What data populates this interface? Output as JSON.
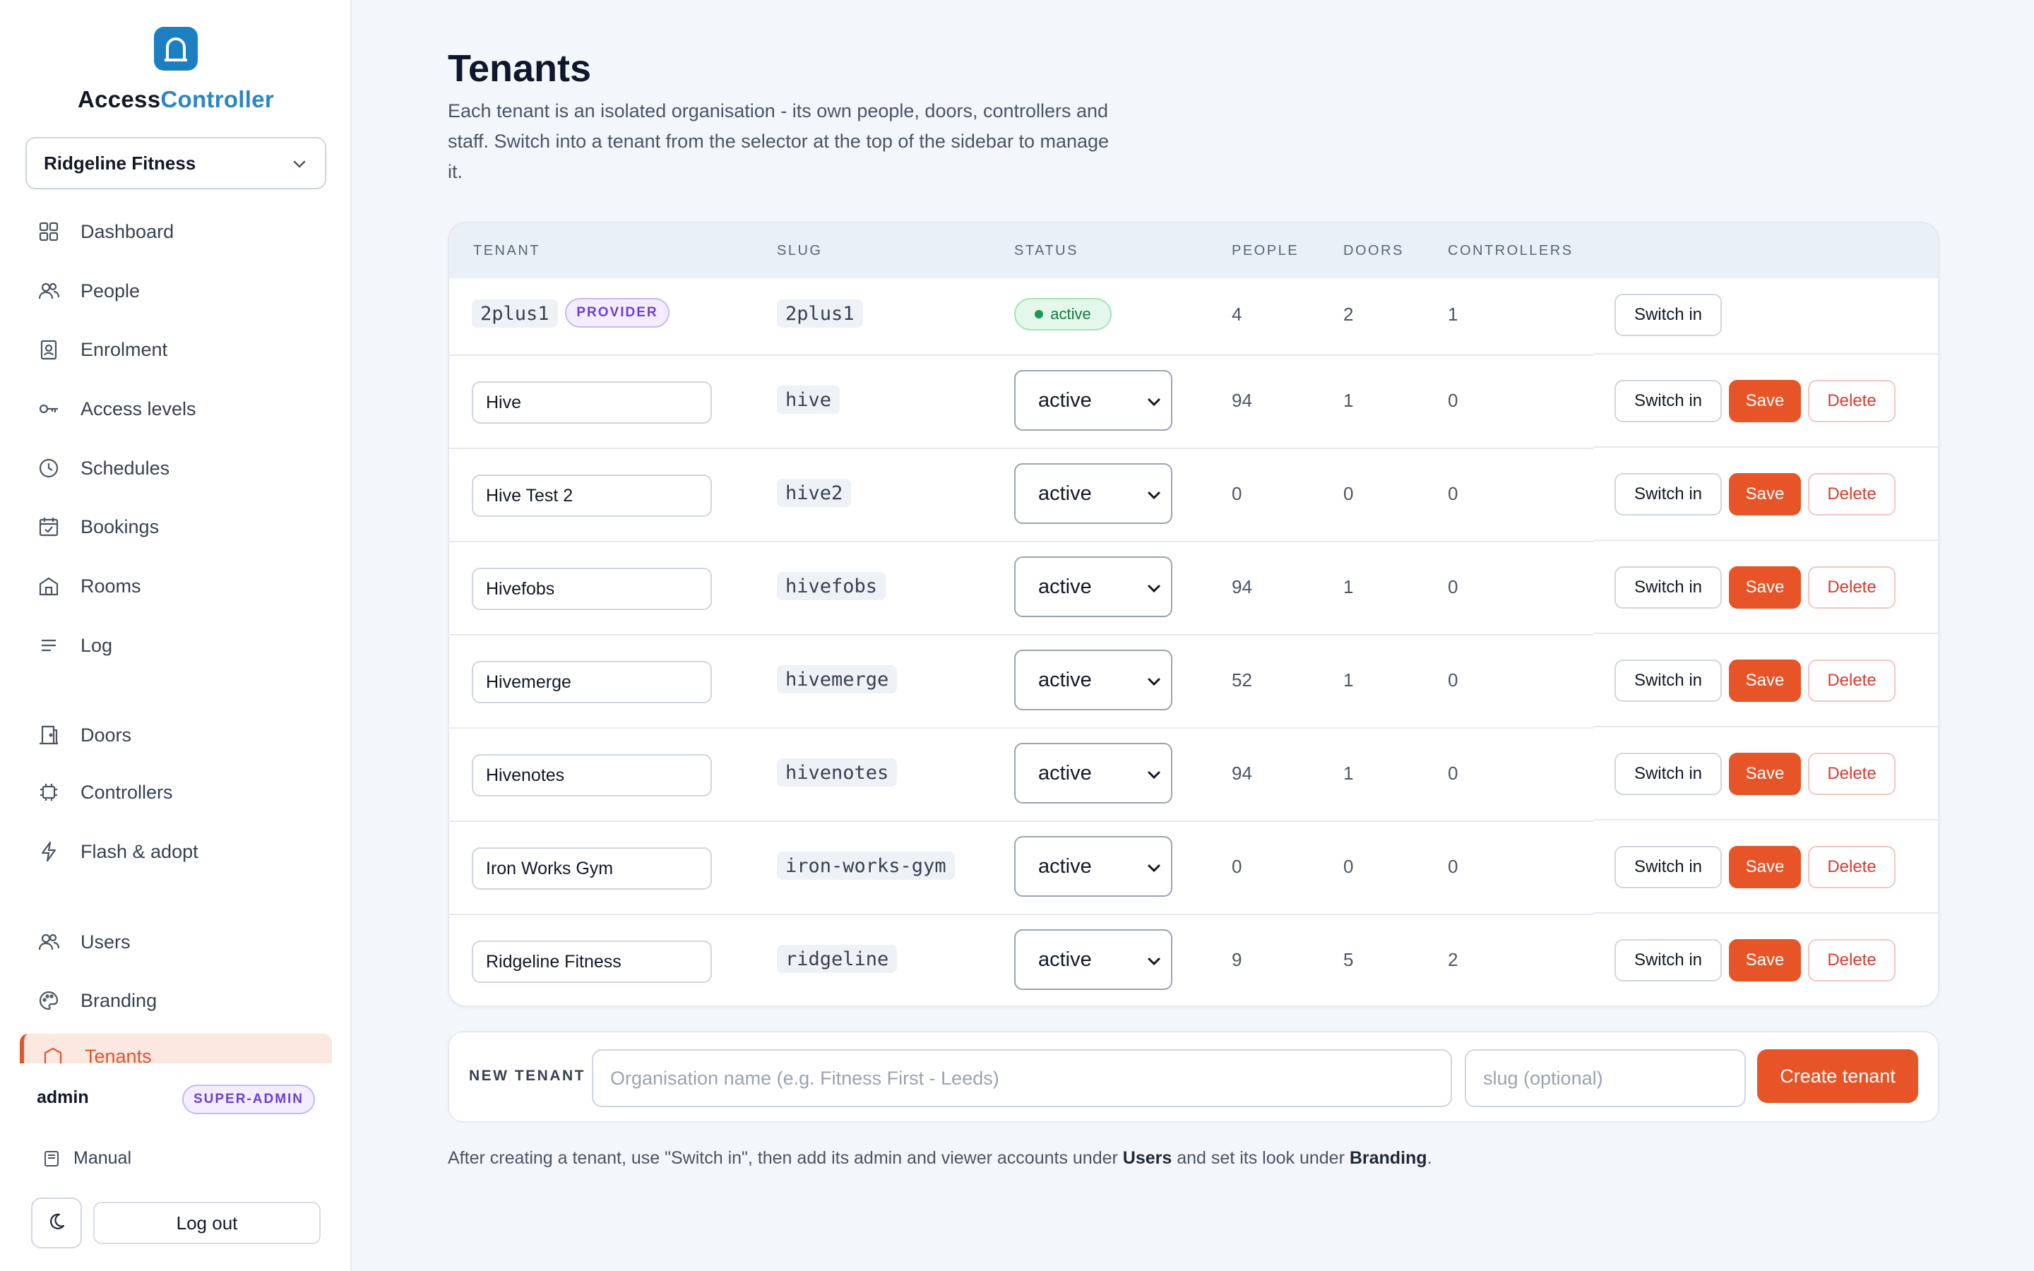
{
  "sidebar": {
    "brand_a": "Access",
    "brand_b": "Controller",
    "tenant_selected": "Ridgeline Fitness",
    "items": [
      {
        "label": "Dashboard",
        "icon": "grid-icon"
      },
      {
        "label": "People",
        "icon": "people-icon"
      },
      {
        "label": "Enrolment",
        "icon": "badge-icon"
      },
      {
        "label": "Access levels",
        "icon": "key-icon"
      },
      {
        "label": "Schedules",
        "icon": "clock-icon"
      },
      {
        "label": "Bookings",
        "icon": "calendar-check-icon"
      },
      {
        "label": "Rooms",
        "icon": "room-icon"
      },
      {
        "label": "Log",
        "icon": "list-icon"
      },
      {
        "label": "Doors",
        "icon": "door-icon"
      },
      {
        "label": "Controllers",
        "icon": "chip-icon"
      },
      {
        "label": "Flash & adopt",
        "icon": "bolt-icon"
      },
      {
        "label": "Users",
        "icon": "users-icon"
      },
      {
        "label": "Branding",
        "icon": "palette-icon"
      },
      {
        "label": "Tenants",
        "icon": "building-icon",
        "active": true
      }
    ],
    "user": "admin",
    "user_role": "SUPER-ADMIN",
    "manual_label": "Manual",
    "logout_label": "Log out"
  },
  "page": {
    "title": "Tenants",
    "description": "Each tenant is an isolated organisation - its own people, doors, controllers and staff. Switch into a tenant from the selector at the top of the sidebar to manage it."
  },
  "table": {
    "headers": {
      "tenant": "TENANT",
      "slug": "SLUG",
      "status": "STATUS",
      "people": "PEOPLE",
      "doors": "DOORS",
      "controllers": "CONTROLLERS"
    },
    "provider": {
      "name": "2plus1",
      "badge": "PROVIDER",
      "slug": "2plus1",
      "status": "active",
      "people": "4",
      "doors": "2",
      "controllers": "1",
      "switch_label": "Switch in"
    },
    "rows": [
      {
        "name": "Hive",
        "slug": "hive",
        "status": "active",
        "people": "94",
        "doors": "1",
        "controllers": "0"
      },
      {
        "name": "Hive Test 2",
        "slug": "hive2",
        "status": "active",
        "people": "0",
        "doors": "0",
        "controllers": "0"
      },
      {
        "name": "Hivefobs",
        "slug": "hivefobs",
        "status": "active",
        "people": "94",
        "doors": "1",
        "controllers": "0"
      },
      {
        "name": "Hivemerge",
        "slug": "hivemerge",
        "status": "active",
        "people": "52",
        "doors": "1",
        "controllers": "0"
      },
      {
        "name": "Hivenotes",
        "slug": "hivenotes",
        "status": "active",
        "people": "94",
        "doors": "1",
        "controllers": "0"
      },
      {
        "name": "Iron Works Gym",
        "slug": "iron-works-gym",
        "status": "active",
        "people": "0",
        "doors": "0",
        "controllers": "0"
      },
      {
        "name": "Ridgeline Fitness",
        "slug": "ridgeline",
        "status": "active",
        "people": "9",
        "doors": "5",
        "controllers": "2"
      }
    ],
    "switch_label": "Switch in",
    "save_label": "Save",
    "delete_label": "Delete"
  },
  "new_tenant": {
    "label": "NEW TENANT",
    "name_placeholder": "Organisation name (e.g. Fitness First - Leeds)",
    "slug_placeholder": "slug (optional)",
    "create_label": "Create tenant"
  },
  "footer": {
    "part1": "After creating a tenant, use \"Switch in\", then add its admin and viewer accounts under ",
    "users": "Users",
    "part2": " and set its look under ",
    "branding": "Branding",
    "part3": "."
  },
  "colors": {
    "accent": "#e65427",
    "brand_blue": "#1b7fc2",
    "status_green": "#1b9a4b",
    "badge_purple": "#6d3fd3"
  }
}
